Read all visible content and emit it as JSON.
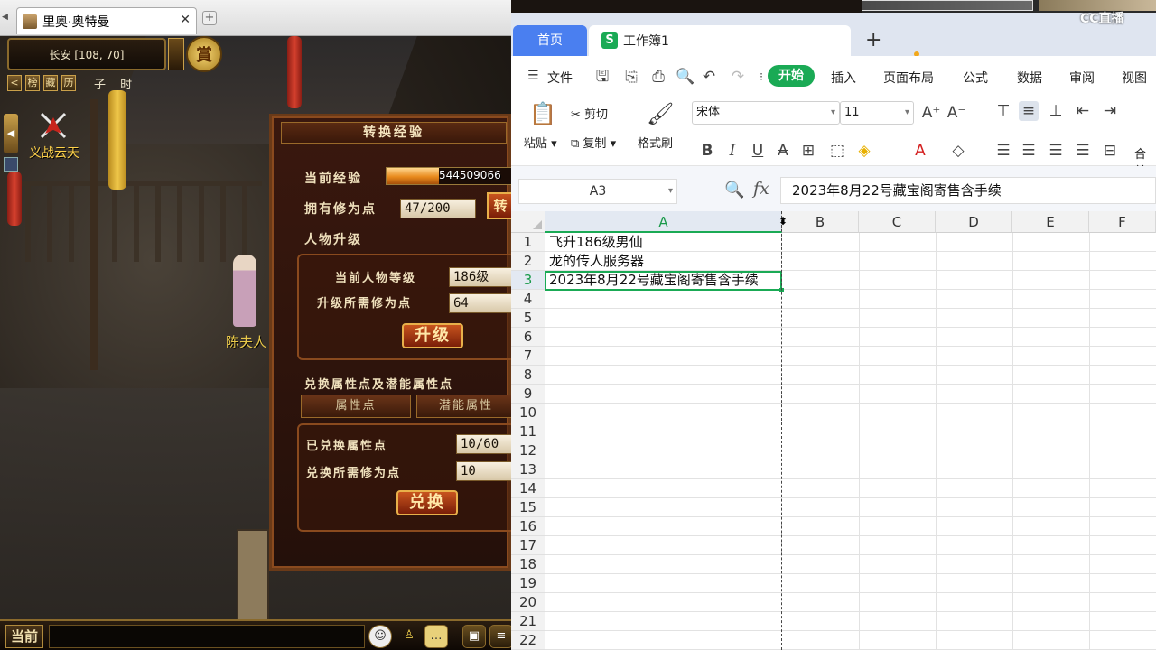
{
  "game": {
    "tab_title": "里奥·奥特曼",
    "tab_close": "✕",
    "new_tab": "+",
    "location": "长安 [108, 70]",
    "badge": "賞",
    "hud_buttons": [
      "<",
      "榜",
      "藏",
      "历"
    ],
    "time": "子 时",
    "war_label": "义战云天",
    "npc_name": "陈夫人",
    "chat_label": "当前",
    "dialog": {
      "title": "转换经验",
      "current_exp_label": "当前经验",
      "current_exp_value": "544509066",
      "exp_fill": 0.42,
      "cultivation_label": "拥有修为点",
      "cultivation_value": "47/200",
      "convert_btn": "转",
      "upgrade_section": "人物升级",
      "level_label": "当前人物等级",
      "level_value": "186级",
      "required_label": "升级所需修为点",
      "required_value": "64",
      "upgrade_btn": "升级",
      "attr_section": "兑换属性点及潜能属性点",
      "tab_attr": "属性点",
      "tab_potential": "潜能属性",
      "exchanged_label": "已兑换属性点",
      "exchanged_value": "10/60",
      "exchange_cost_label": "兑换所需修为点",
      "exchange_cost_value": "10",
      "exchange_btn": "兑换"
    }
  },
  "wps": {
    "home_tab": "首页",
    "doc_tab": "工作簿1",
    "doc_icon": "S",
    "new_tab": "+",
    "menu": {
      "file": "文件",
      "start": "开始",
      "insert": "插入",
      "layout": "页面布局",
      "formula": "公式",
      "data": "数据",
      "review": "审阅",
      "view": "视图"
    },
    "ribbon": {
      "paste": "粘贴",
      "cut": "剪切",
      "copy": "复制",
      "format_painter": "格式刷",
      "font": "宋体",
      "size": "11",
      "merge": "合并"
    },
    "name_box": "A3",
    "formula_content": "2023年8月22号藏宝阁寄售含手续",
    "columns": [
      "A",
      "B",
      "C",
      "D",
      "E",
      "F"
    ],
    "rows": [
      "1",
      "2",
      "3",
      "4",
      "5",
      "6",
      "7",
      "8",
      "9",
      "10",
      "11",
      "12",
      "13",
      "14",
      "15",
      "16",
      "17",
      "18",
      "19",
      "20",
      "21",
      "22"
    ],
    "cells": {
      "A1": "飞升186级男仙",
      "A2": "龙的传人服务器",
      "A3": "2023年8月22号藏宝阁寄售含手续"
    }
  },
  "overlay": {
    "logo": "CC直播"
  }
}
